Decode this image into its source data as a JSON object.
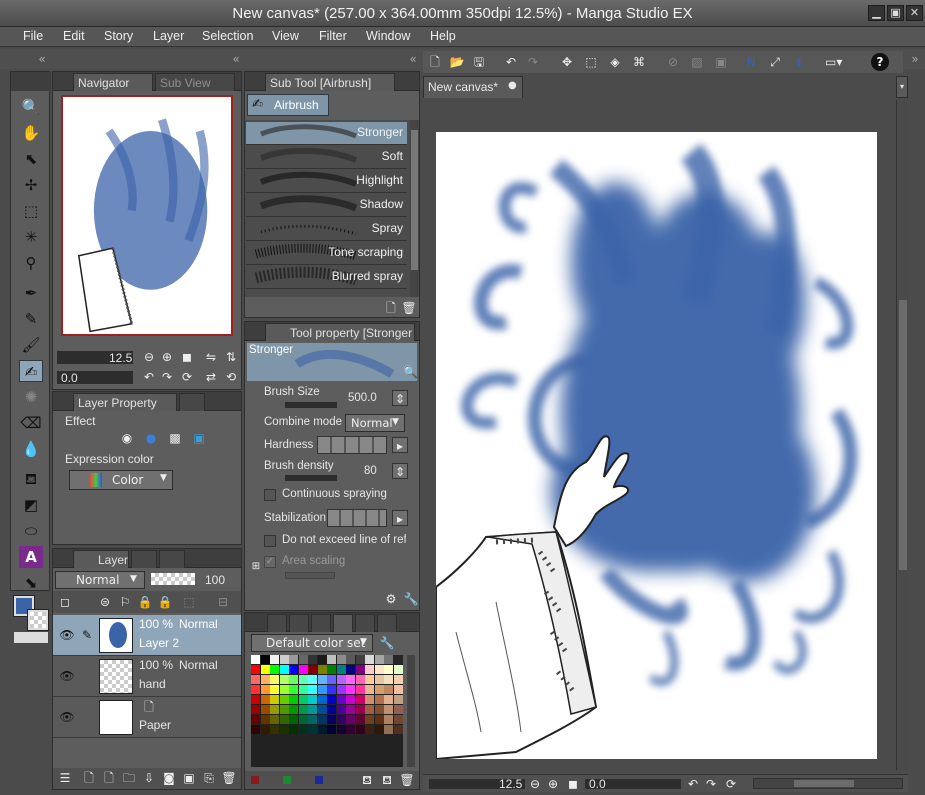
{
  "window": {
    "title": "New canvas* (257.00 x 364.00mm 350dpi 12.5%)  - Manga Studio EX"
  },
  "menu": [
    "File",
    "Edit",
    "Story",
    "Layer",
    "Selection",
    "View",
    "Filter",
    "Window",
    "Help"
  ],
  "navigator": {
    "tabs": [
      "Navigator",
      "Sub View"
    ],
    "zoom": "12.5",
    "angle": "0.0"
  },
  "subtool": {
    "tab": "Sub Tool [Airbrush]",
    "group": "Airbrush",
    "brushes": [
      "Stronger",
      "Soft",
      "Highlight",
      "Shadow",
      "Spray",
      "Tone scraping",
      "Blurred spray"
    ],
    "selected": "Stronger"
  },
  "toolprop": {
    "tab": "Tool property [Stronger",
    "preset": "Stronger",
    "brush_size_label": "Brush Size",
    "brush_size": "500.0",
    "combine_label": "Combine mode",
    "combine_value": "Normal",
    "hardness_label": "Hardness",
    "density_label": "Brush density",
    "density": "80",
    "continuous_label": "Continuous spraying",
    "stabilization_label": "Stabilization",
    "no_exceed_label": "Do not exceed line of ref",
    "area_scaling_label": "Area scaling"
  },
  "layerprop": {
    "tab": "Layer Property",
    "effect_label": "Effect",
    "expr_label": "Expression color",
    "expr_value": "Color"
  },
  "layers": {
    "tab": "Layer",
    "blend": "Normal",
    "opacity": "100",
    "items": [
      {
        "pct": "100 %",
        "mode": "Normal",
        "name": "Layer 2"
      },
      {
        "pct": "100 %",
        "mode": "Normal",
        "name": "hand"
      },
      {
        "pct": "",
        "mode": "",
        "name": "Paper"
      }
    ]
  },
  "colorset": {
    "name": "Default color set"
  },
  "canvas": {
    "tab": "New canvas*",
    "zoom": "12.5",
    "angle": "0.0"
  },
  "colors": {
    "main": "#3b63a8",
    "accent": "#8fa6b8"
  }
}
